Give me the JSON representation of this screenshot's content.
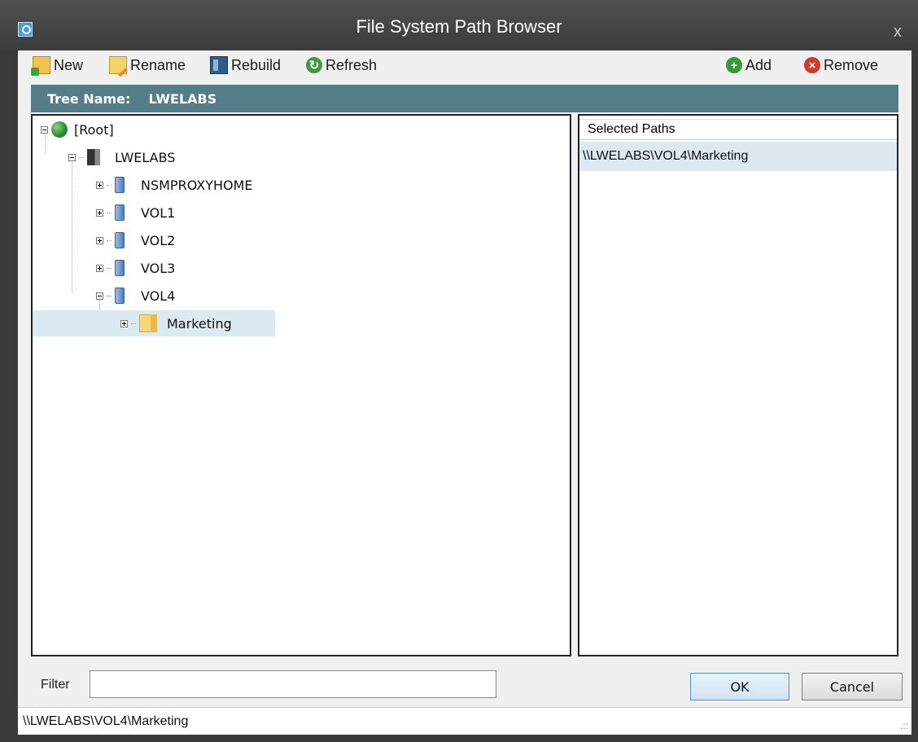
{
  "window": {
    "title": "File System Path Browser",
    "close_label": "x"
  },
  "toolbar": {
    "new_label": "New",
    "rename_label": "Rename",
    "rebuild_label": "Rebuild",
    "refresh_label": "Refresh",
    "add_label": "Add",
    "remove_label": "Remove"
  },
  "tree_header": {
    "label": "Tree Name:",
    "value": "LWELABS"
  },
  "tree": {
    "root": "[Root]",
    "server": "LWELABS",
    "volumes": [
      "NSMPROXYHOME",
      "VOL1",
      "VOL2",
      "VOL3",
      "VOL4"
    ],
    "folder": "Marketing"
  },
  "selected_paths": {
    "header": "Selected Paths",
    "items": [
      "\\\\LWELABS\\VOL4\\Marketing"
    ]
  },
  "filter": {
    "label": "Filter",
    "value": ""
  },
  "buttons": {
    "ok": "OK",
    "cancel": "Cancel"
  },
  "status": {
    "path": "\\\\LWELABS\\VOL4\\Marketing"
  },
  "colors": {
    "tree_header_bg": "#547d8a",
    "selection_bg": "#dbe9f2",
    "title_bar": "#3c3c3c"
  }
}
